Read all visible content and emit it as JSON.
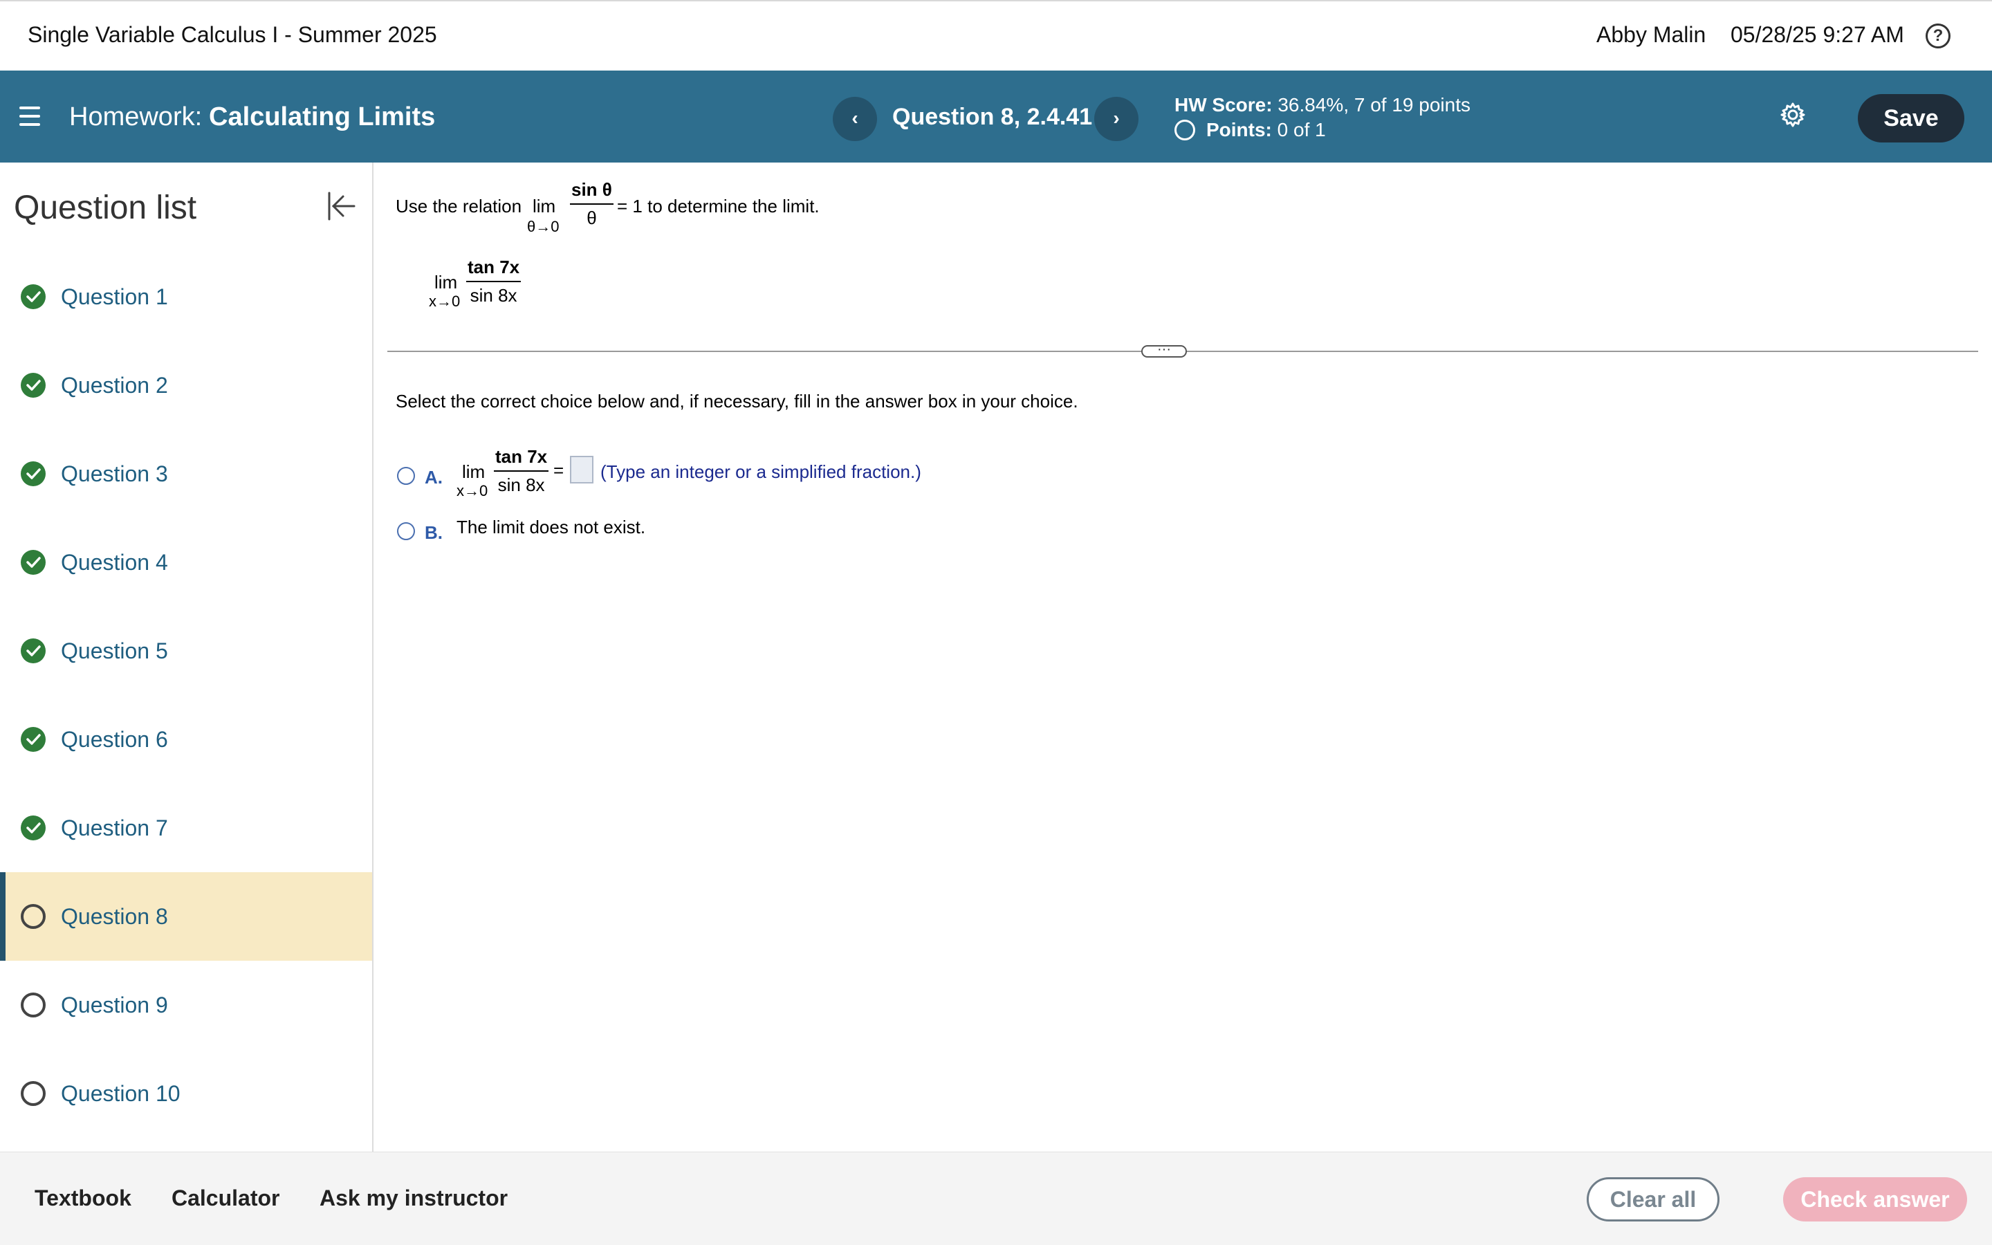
{
  "topbar": {
    "course_title": "Single Variable Calculus I - Summer 2025",
    "user_name": "Abby Malin",
    "date_time": "05/28/25 9:27 AM",
    "help_icon": "?"
  },
  "header": {
    "menu_icon": "hamburger-menu-icon",
    "homework_label": "Homework:",
    "homework_name": "Calculating Limits",
    "prev_icon": "‹",
    "next_icon": "›",
    "question_label": "Question 8, 2.4.41",
    "hw_score_label": "HW Score:",
    "hw_score_value": " 36.84%, 7 of 19 points",
    "points_label": "Points:",
    "points_value": " 0 of 1",
    "save_label": "Save",
    "accent_color": "#2e6e8e"
  },
  "sidebar": {
    "title": "Question list",
    "items": [
      {
        "label": "Question 1",
        "status": "complete"
      },
      {
        "label": "Question 2",
        "status": "complete"
      },
      {
        "label": "Question 3",
        "status": "complete"
      },
      {
        "label": "Question 4",
        "status": "complete"
      },
      {
        "label": "Question 5",
        "status": "complete"
      },
      {
        "label": "Question 6",
        "status": "complete"
      },
      {
        "label": "Question 7",
        "status": "complete"
      },
      {
        "label": "Question 8",
        "status": "current"
      },
      {
        "label": "Question 9",
        "status": "incomplete"
      },
      {
        "label": "Question 10",
        "status": "incomplete"
      }
    ]
  },
  "question": {
    "intro_prefix": "Use the relation",
    "relation_lim": "lim",
    "relation_sub": "θ→0",
    "relation_num": "sin θ",
    "relation_den": "θ",
    "intro_suffix": "= 1 to determine the limit.",
    "expr_lim": "lim",
    "expr_sub": "x→0",
    "expr_num": "tan 7x",
    "expr_den": "sin 8x",
    "instruction": "Select the correct choice below and, if necessary, fill in the answer box in your choice.",
    "choice_a_letter": "A.",
    "choice_a_lim": "lim",
    "choice_a_sub": "x→0",
    "choice_a_num": "tan 7x",
    "choice_a_den": "sin 8x",
    "choice_a_eq": "=",
    "choice_a_answer": "",
    "choice_a_hint": "(Type an integer or a simplified fraction.)",
    "choice_b_letter": "B.",
    "choice_b_text": "The limit does not exist."
  },
  "footer": {
    "textbook": "Textbook",
    "calculator": "Calculator",
    "ask_instructor": "Ask my instructor",
    "clear_all": "Clear all",
    "check_answer": "Check answer"
  }
}
